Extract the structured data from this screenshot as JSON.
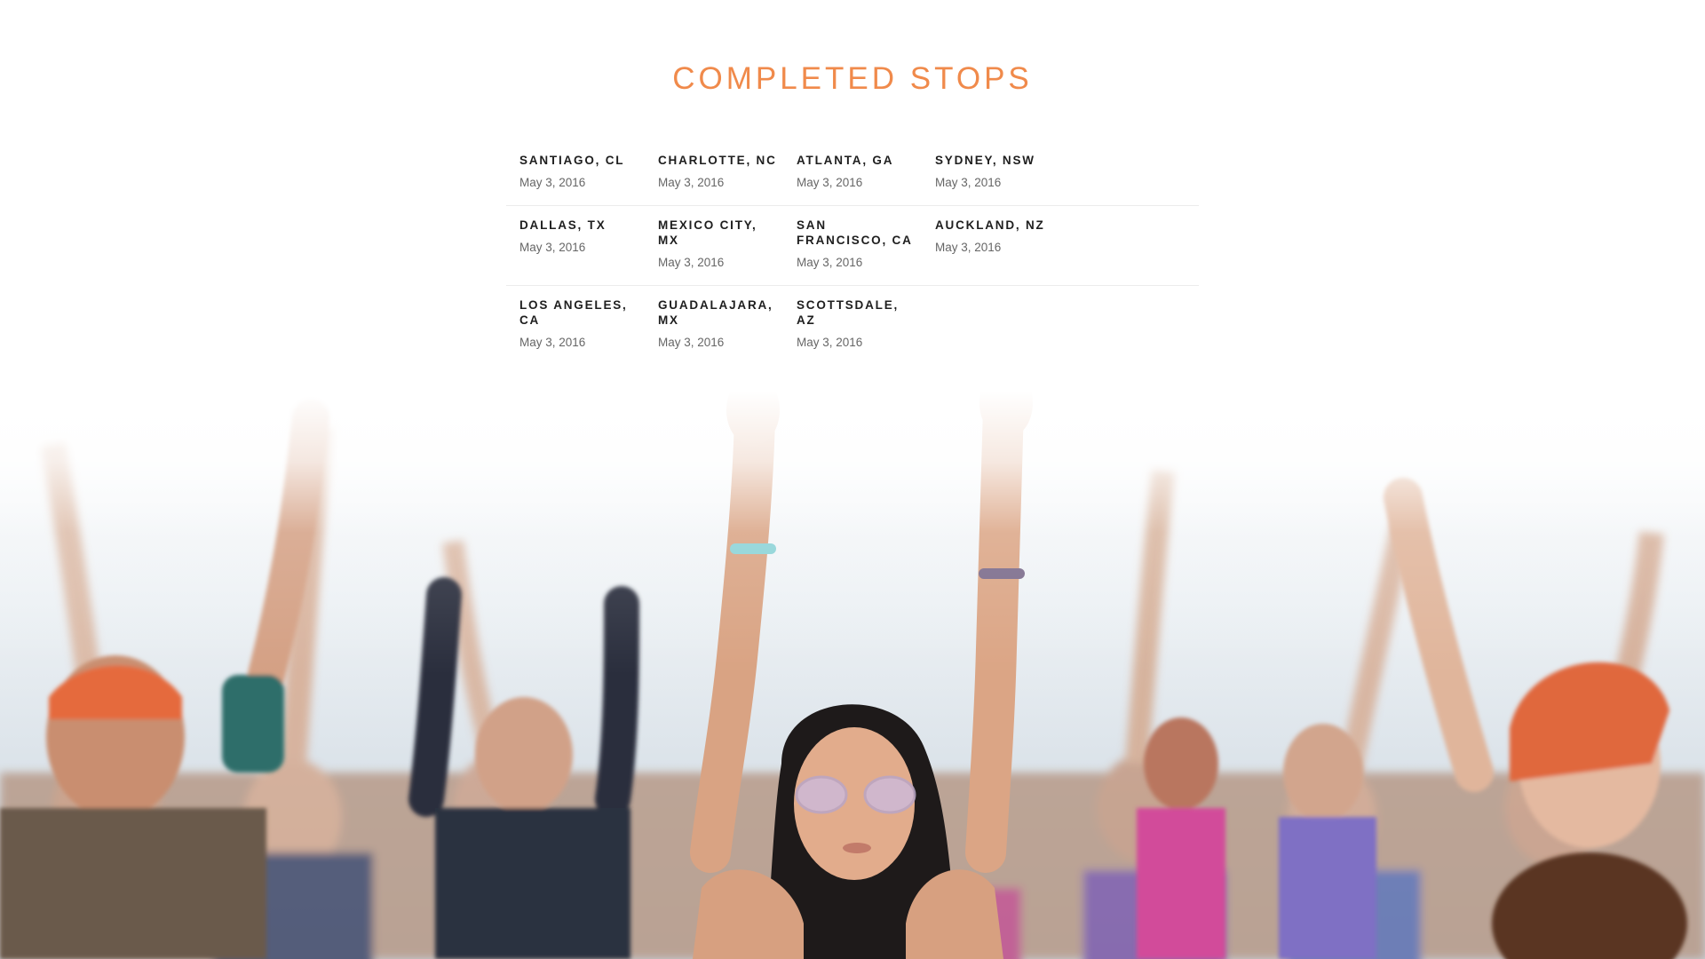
{
  "section": {
    "title": "COMPLETED STOPS"
  },
  "stops": [
    [
      {
        "city": "SANTIAGO, CL",
        "date": "May 3, 2016"
      },
      {
        "city": "CHARLOTTE, NC",
        "date": "May 3, 2016"
      },
      {
        "city": "ATLANTA, GA",
        "date": "May 3, 2016"
      },
      {
        "city": "SYDNEY, NSW",
        "date": "May 3, 2016"
      }
    ],
    [
      {
        "city": "DALLAS, TX",
        "date": "May 3, 2016"
      },
      {
        "city": "MEXICO CITY, MX",
        "date": "May 3, 2016"
      },
      {
        "city": "SAN FRANCISCO, CA",
        "date": "May 3, 2016"
      },
      {
        "city": "AUCKLAND, NZ",
        "date": "May 3, 2016"
      }
    ],
    [
      {
        "city": "LOS ANGELES, CA",
        "date": "May 3, 2016"
      },
      {
        "city": "GUADALAJARA, MX",
        "date": "May 3, 2016"
      },
      {
        "city": "SCOTTSDALE, AZ",
        "date": "May 3, 2016"
      }
    ]
  ],
  "colors": {
    "accent": "#f08a4b",
    "city_text": "#1e1e1e",
    "date_text": "#666666",
    "divider": "#ececec"
  },
  "hero": {
    "image": "crowd-raising-arms-photo"
  }
}
